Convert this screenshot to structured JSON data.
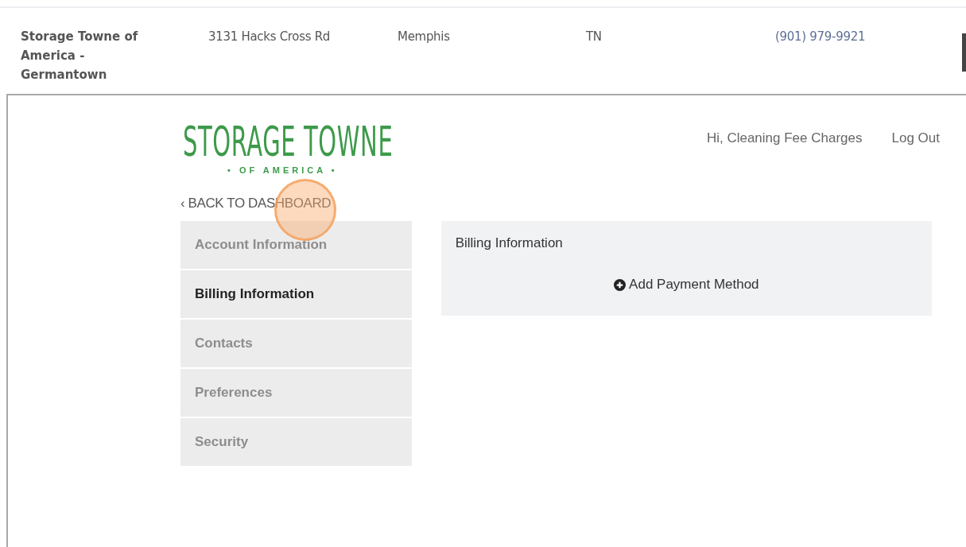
{
  "location_row": {
    "name": "Storage Towne of America - Germantown",
    "address": "3131 Hacks Cross Rd",
    "city": "Memphis",
    "state": "TN",
    "phone": "(901) 979-9921"
  },
  "logo": {
    "title": "STORAGE TOWNE",
    "subtitle": "• OF AMERICA •"
  },
  "header": {
    "greeting": "Hi, Cleaning Fee Charges",
    "logout": "Log Out"
  },
  "back_link": "‹ BACK TO DASHBOARD",
  "click_indicator": true,
  "sidebar": {
    "items": [
      {
        "label": "Account Information",
        "selected": false
      },
      {
        "label": "Billing Information",
        "selected": true
      },
      {
        "label": "Contacts",
        "selected": false
      },
      {
        "label": "Preferences",
        "selected": false
      },
      {
        "label": "Security",
        "selected": false
      }
    ]
  },
  "panel": {
    "title": "Billing Information",
    "action": "Add Payment Method"
  }
}
